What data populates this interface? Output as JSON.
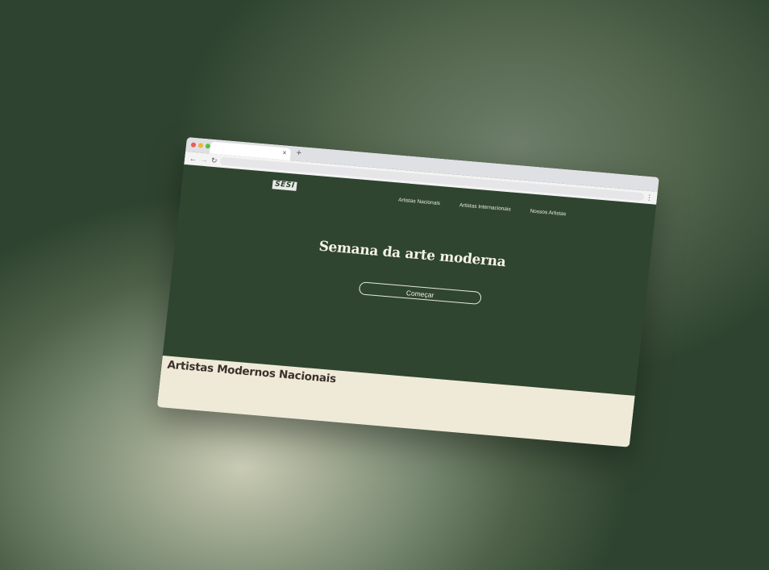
{
  "browser": {
    "traffic_lights": [
      "#ee5a55",
      "#f0b43c",
      "#55c143"
    ],
    "tab_close": "×",
    "new_tab": "+",
    "back": "←",
    "forward": "→",
    "reload": "↻",
    "menu": "⋮"
  },
  "site": {
    "logo": "SESI",
    "nav": [
      "Artistas Nacionais",
      "Artistas Internacionais",
      "Nossos Artistas"
    ],
    "hero_title": "Semana da arte moderna",
    "cta_label": "Começar",
    "section_title": "Artistas Modernos Nacionais"
  },
  "colors": {
    "hero_bg": "#2f452f",
    "section_bg": "#efead8",
    "backdrop": "#2f4430"
  }
}
